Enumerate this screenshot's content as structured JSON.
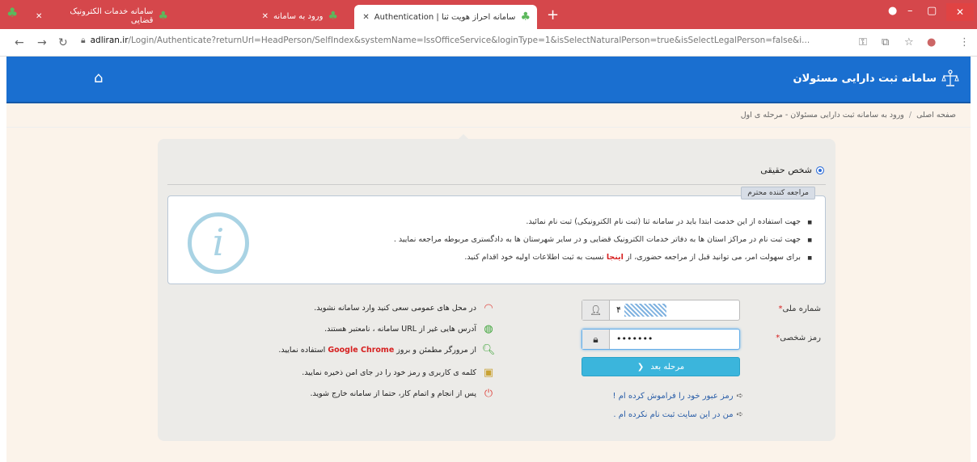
{
  "browser": {
    "tabs": [
      {
        "title": "سامانه خدمات الکترونیک قضایی"
      },
      {
        "title": "ورود به سامانه"
      },
      {
        "title": "سامانه احراز هویت ثنا | Authentication"
      }
    ],
    "url": {
      "host": "adliran.ir",
      "rest": "/Login/Authenticate?returnUrl=HeadPerson/SelfIndex&systemName=IssOfficeService&loginType=1&isSelectNaturalPerson=true&isSelectLegalPerson=false&i..."
    }
  },
  "header": {
    "title": "سامانه ثبت دارایی مسئولان"
  },
  "breadcrumb": {
    "home": "صفحه اصلی",
    "current": "ورود به سامانه ثبت دارایی مسئولان - مرحله ی اول"
  },
  "form": {
    "person_type": "شخص حقیقی",
    "notice": {
      "tag": "مراجعه کننده محترم",
      "items": [
        "جهت استفاده از این خدمت ابتدا باید در سامانه ثنا (ثبت نام الکترونیکی) ثبت نام نمائید.",
        "جهت ثبت نام در مراکز استان ها به دفاتر خدمات الکترونیک قضایی و در سایر شهرستان ها به دادگستری مربوطه مراجعه نمایید .",
        "برای سهولت امر، می توانید قبل از مراجعه حضوری، از",
        "اینجا",
        "نسبت به ثبت اطلاعات اولیه خود اقدام کنید."
      ]
    },
    "national_code_label": "شماره ملی",
    "national_code_value": "۴",
    "password_label": "رمز شخصی",
    "password_value": "•••••••",
    "next_button": "مرحله بعد",
    "forgot_link": "رمز عبور خود را فراموش کرده ام !",
    "register_link": "من در این سایت ثبت نام نکرده ام ."
  },
  "security_tips": [
    {
      "icon": "wifi-icon",
      "text": "در محل های عمومی سعی کنید وارد سامانه نشوید."
    },
    {
      "icon": "globe-icon",
      "text": "آدرس هایی غیر از URL سامانه ، نامعتبر هستند."
    },
    {
      "icon": "magnifier-icon",
      "text_pre": "از مرورگر مطمئن و بروز",
      "text_brand": "Google Chrome",
      "text_post": "استفاده نمایید."
    },
    {
      "icon": "password-box-icon",
      "text": "کلمه ی کاربری و رمز خود را در جای امن ذخیره نمایید."
    },
    {
      "icon": "power-icon",
      "text": "پس از انجام و اتمام کار، حتما از سامانه خارج شوید."
    }
  ],
  "colors": {
    "browser_tabbar": "#d5474b",
    "header_blue": "#1a6fd0",
    "button_cyan": "#3bb5dc",
    "page_bg": "#fbf3ea",
    "panel_bg": "#ecebe8"
  }
}
